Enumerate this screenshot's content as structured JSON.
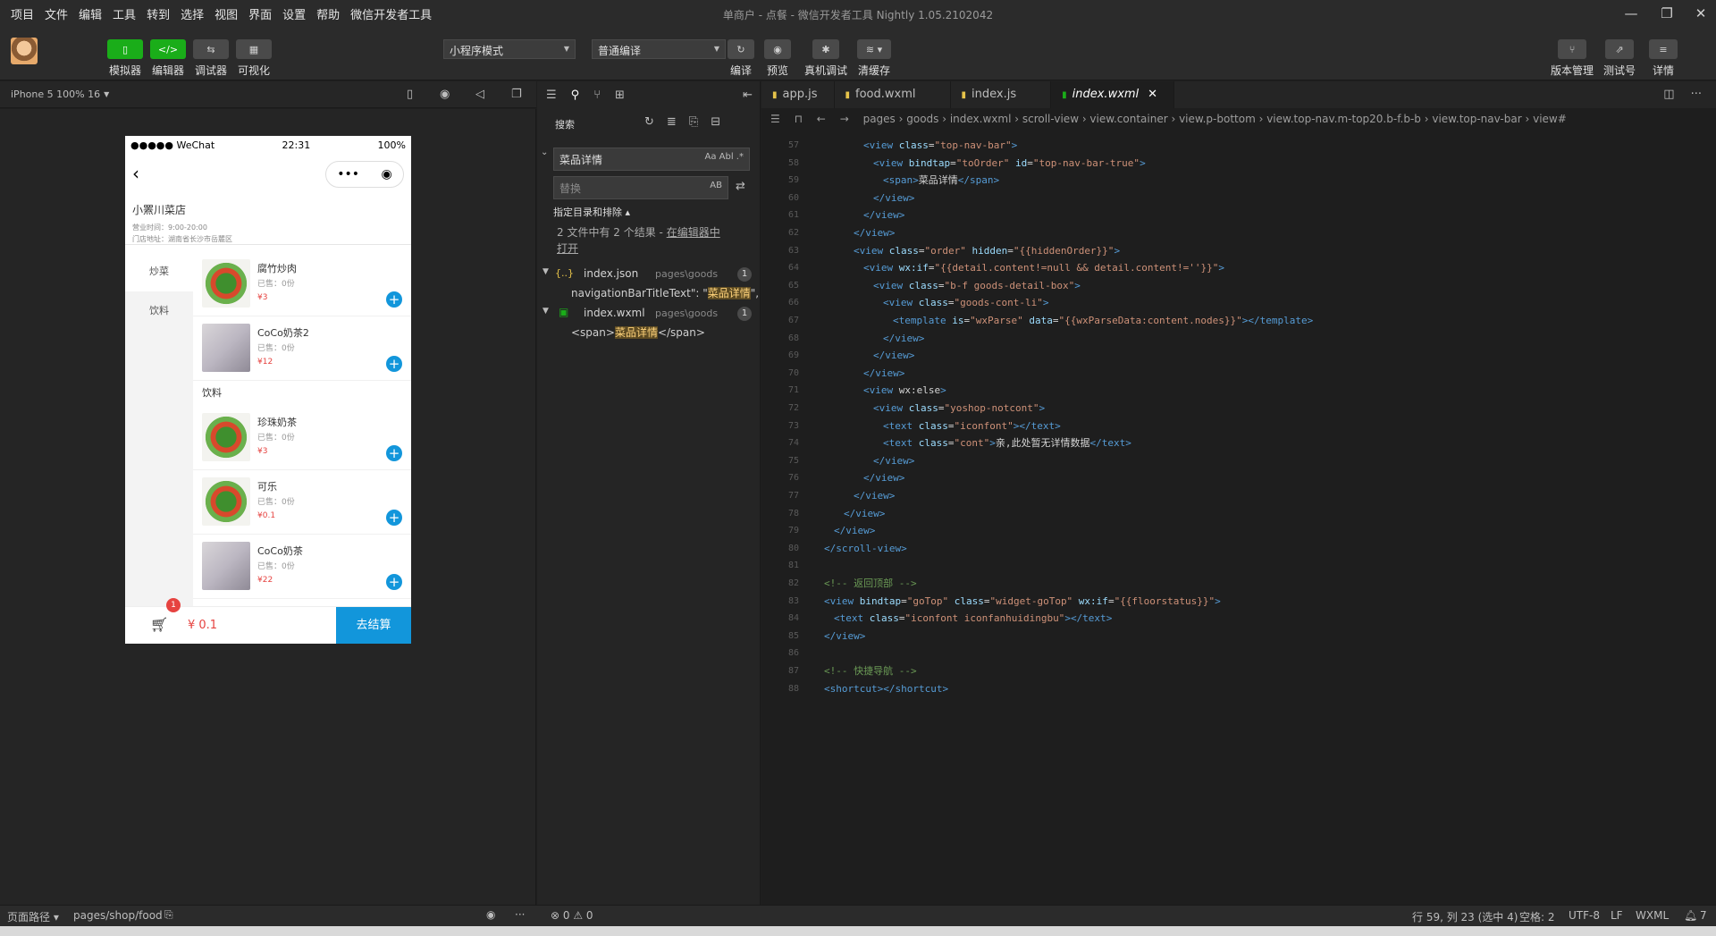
{
  "menu": [
    "项目",
    "文件",
    "编辑",
    "工具",
    "转到",
    "选择",
    "视图",
    "界面",
    "设置",
    "帮助",
    "微信开发者工具"
  ],
  "window_title": "单商户 - 点餐 - 微信开发者工具 Nightly 1.05.2102042",
  "toolbar": {
    "left_buttons": [
      "模拟器",
      "编辑器",
      "调试器",
      "可视化"
    ],
    "mode_select": "小程序模式",
    "compile_select": "普通编译",
    "mid_buttons": [
      "编译",
      "预览",
      "真机调试",
      "清缓存"
    ],
    "right_buttons": [
      "版本管理",
      "测试号",
      "详情"
    ]
  },
  "simulator": {
    "device": "iPhone 5 100% 16",
    "status_left": "●●●●● WeChat",
    "status_time": "22:31",
    "status_battery": "100%",
    "capsule_more": "•••",
    "capsule_close": "◉",
    "store_name": "小罴川菜店",
    "store_hours": "营业时间：9:00-20:00",
    "store_address": "门店地址：湖南省长沙市岳麓区",
    "categories": [
      "炒菜",
      "饮料"
    ],
    "goods_top": [
      {
        "name": "腐竹炒肉",
        "sold": "已售：0份",
        "price": "¥3"
      },
      {
        "name": "CoCo奶茶2",
        "sold": "已售：0份",
        "price": "¥12"
      }
    ],
    "section_title": "饮料",
    "goods_bottom": [
      {
        "name": "珍珠奶茶",
        "sold": "已售：0份",
        "price": "¥3"
      },
      {
        "name": "可乐",
        "sold": "已售：0份",
        "price": "¥0.1"
      },
      {
        "name": "CoCo奶茶",
        "sold": "已售：0份",
        "price": "¥22"
      }
    ],
    "cart_badge": "1",
    "cart_total": "¥ 0.1",
    "checkout": "去结算"
  },
  "search": {
    "title": "搜索",
    "query": "菜品详情",
    "query_opts": "Aa  Abl  .*",
    "replace_placeholder": "替换",
    "replace_opts": "AB",
    "include_toggle": "指定目录和排除 ▴",
    "summary": "2 文件中有 2 个结果 - ",
    "summary_link": "在编辑器中",
    "summary_link2": "打开",
    "results": [
      {
        "file": "index.json",
        "path": "pages\\goods",
        "count": "1",
        "line_pre": "navigationBarTitleText\": \"",
        "line_hl": "菜品详情",
        "line_post": "\","
      },
      {
        "file": "index.wxml",
        "path": "pages\\goods",
        "count": "1",
        "line_pre": "<span>",
        "line_hl": "菜品详情",
        "line_post": "</span>"
      }
    ]
  },
  "editor": {
    "tabs": [
      "app.js",
      "food.wxml",
      "index.js",
      "index.wxml"
    ],
    "breadcrumb": "pages › goods › index.wxml › scroll-view › view.container › view.p-bottom › view.top-nav.m-top20.b-f.b-b › view.top-nav-bar › view#",
    "lines": [
      {
        "n": "57",
        "indent": 4,
        "html": "<view class=\"top-nav-bar\">"
      },
      {
        "n": "58",
        "indent": 5,
        "html": "<view bindtap=\"toOrder\" id=\"top-nav-bar-true\">"
      },
      {
        "n": "59",
        "indent": 6,
        "html": "<span>菜品详情</span>"
      },
      {
        "n": "60",
        "indent": 5,
        "html": "</view>"
      },
      {
        "n": "61",
        "indent": 4,
        "html": "</view>"
      },
      {
        "n": "62",
        "indent": 3,
        "html": "</view>"
      },
      {
        "n": "63",
        "indent": 3,
        "html": "<view class=\"order\" hidden=\"{{hiddenOrder}}\">"
      },
      {
        "n": "64",
        "indent": 4,
        "html": "<view wx:if=\"{{detail.content!=null && detail.content!=''}}\">"
      },
      {
        "n": "65",
        "indent": 5,
        "html": "<view class=\"b-f goods-detail-box\">"
      },
      {
        "n": "66",
        "indent": 6,
        "html": "<view class=\"goods-cont-li\">"
      },
      {
        "n": "67",
        "indent": 7,
        "html": "<template is=\"wxParse\" data=\"{{wxParseData:content.nodes}}\"></template>"
      },
      {
        "n": "68",
        "indent": 6,
        "html": "</view>"
      },
      {
        "n": "69",
        "indent": 5,
        "html": "</view>"
      },
      {
        "n": "70",
        "indent": 4,
        "html": "</view>"
      },
      {
        "n": "71",
        "indent": 4,
        "html": "<view wx:else>"
      },
      {
        "n": "72",
        "indent": 5,
        "html": "<view class=\"yoshop-notcont\">"
      },
      {
        "n": "73",
        "indent": 6,
        "html": "<text class=\"iconfont\"></text>"
      },
      {
        "n": "74",
        "indent": 6,
        "html": "<text class=\"cont\">亲,此处暂无详情数据</text>"
      },
      {
        "n": "75",
        "indent": 5,
        "html": "</view>"
      },
      {
        "n": "76",
        "indent": 4,
        "html": "</view>"
      },
      {
        "n": "77",
        "indent": 3,
        "html": "</view>"
      },
      {
        "n": "78",
        "indent": 2,
        "html": "</view>"
      },
      {
        "n": "79",
        "indent": 1,
        "html": "</view>"
      },
      {
        "n": "80",
        "indent": 0,
        "html": "</scroll-view>"
      },
      {
        "n": "81",
        "indent": 0,
        "html": ""
      },
      {
        "n": "82",
        "indent": 0,
        "html": "<!-- 返回顶部 -->"
      },
      {
        "n": "83",
        "indent": 0,
        "html": "<view bindtap=\"goTop\" class=\"widget-goTop\" wx:if=\"{{floorstatus}}\">"
      },
      {
        "n": "84",
        "indent": 1,
        "html": "<text class=\"iconfont iconfanhuidingbu\"></text>"
      },
      {
        "n": "85",
        "indent": 0,
        "html": "</view>"
      },
      {
        "n": "86",
        "indent": 0,
        "html": ""
      },
      {
        "n": "87",
        "indent": 0,
        "html": "<!-- 快捷导航 -->"
      },
      {
        "n": "88",
        "indent": 0,
        "html": "<shortcut></shortcut>"
      }
    ]
  },
  "statusbar": {
    "path_label": "页面路径 ▾",
    "page_path": "pages/shop/food",
    "problems": "⊗ 0 ⚠ 0",
    "cursor": "行 59, 列 23 (选中 4)",
    "spaces": "空格: 2",
    "encoding": "UTF-8",
    "eol": "LF",
    "lang": "WXML",
    "notifications": "7"
  }
}
